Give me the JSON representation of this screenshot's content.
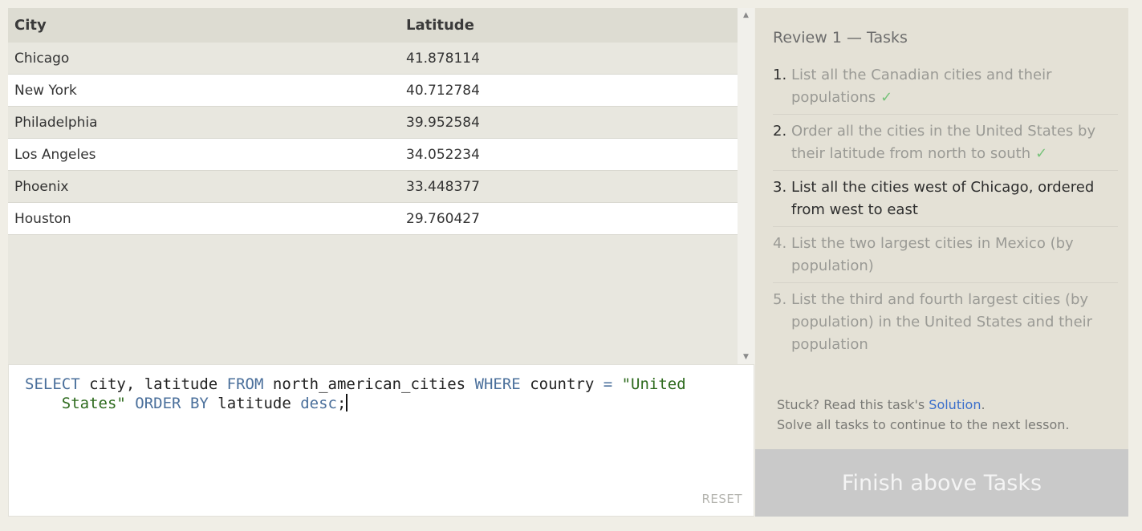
{
  "results": {
    "columns": [
      "City",
      "Latitude"
    ],
    "rows": [
      [
        "Chicago",
        "41.878114"
      ],
      [
        "New York",
        "40.712784"
      ],
      [
        "Philadelphia",
        "39.952584"
      ],
      [
        "Los Angeles",
        "34.052234"
      ],
      [
        "Phoenix",
        "33.448377"
      ],
      [
        "Houston",
        "29.760427"
      ]
    ]
  },
  "editor": {
    "query": "SELECT city, latitude FROM north_american_cities WHERE country = \"United States\" ORDER BY latitude desc;",
    "reset_label": "RESET"
  },
  "tasks": {
    "title": "Review 1 — Tasks",
    "items": [
      {
        "number": "1.",
        "text": "List all the Canadian cities and their populations",
        "status": "completed",
        "check": "✓"
      },
      {
        "number": "2.",
        "text": "Order all the cities in the United States by their latitude from north to south",
        "status": "completed",
        "check": "✓"
      },
      {
        "number": "3.",
        "text": "List all the cities west of Chicago, ordered from west to east",
        "status": "current"
      },
      {
        "number": "4.",
        "text": "List the two largest cities in Mexico (by population)",
        "status": "pending"
      },
      {
        "number": "5.",
        "text": "List the third and fourth largest cities (by population) in the United States and their population",
        "status": "pending"
      }
    ],
    "help_prefix": "Stuck? Read this task's ",
    "help_link": "Solution",
    "help_suffix": ".",
    "help_line2": "Solve all tasks to continue to the next lesson.",
    "finish_label": "Finish above Tasks"
  },
  "colors": {
    "keyword": "#4a6f9b",
    "string": "#2e6b1e",
    "check": "#77c27a",
    "link": "#3b6fcb",
    "button_disabled": "#c9c9c9"
  }
}
